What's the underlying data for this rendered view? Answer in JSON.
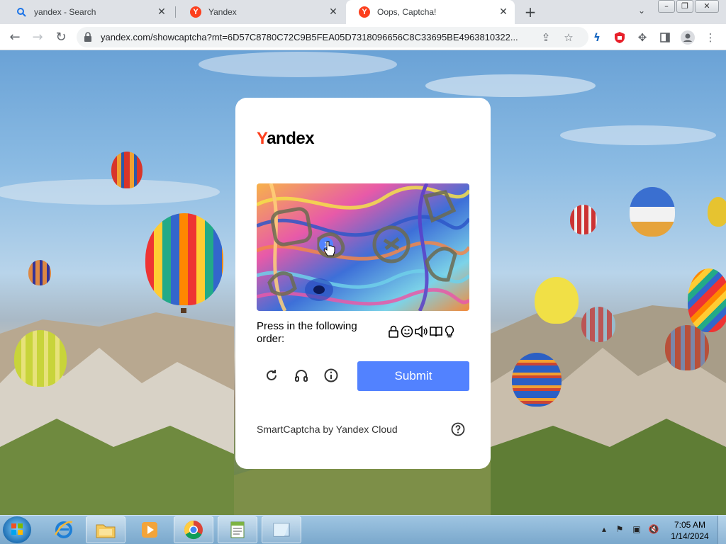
{
  "browser": {
    "tabs": [
      {
        "title": "yandex - Search",
        "icon": "search-icon"
      },
      {
        "title": "Yandex",
        "icon": "yandex-icon"
      },
      {
        "title": "Oops, Captcha!",
        "icon": "yandex-icon",
        "active": true
      }
    ],
    "new_tab_symbol": "+",
    "address": "yandex.com/showcaptcha?mt=6D57C8780C72C9B5FEA05D7318096656C8C33695BE4963810322...",
    "window_controls": [
      "–",
      "❐",
      "✕"
    ]
  },
  "captcha": {
    "logo": {
      "first_letter": "Y",
      "rest": "andex"
    },
    "prompt": "Press in the following order:",
    "order_icons": [
      "lock-icon",
      "smiley-icon",
      "speaker-icon",
      "book-icon",
      "lightbulb-icon"
    ],
    "clicked_marker": "1",
    "submit_label": "Submit",
    "footer": "SmartCaptcha by Yandex Cloud",
    "accent_color": "#5282ff",
    "brand_color": "#fc3f1d"
  },
  "taskbar": {
    "pinned": [
      "internet-explorer-icon",
      "file-explorer-icon",
      "media-player-icon",
      "chrome-icon",
      "notepad-icon",
      "window-icon"
    ],
    "clock": {
      "time": "7:05 AM",
      "date": "1/14/2024"
    }
  }
}
